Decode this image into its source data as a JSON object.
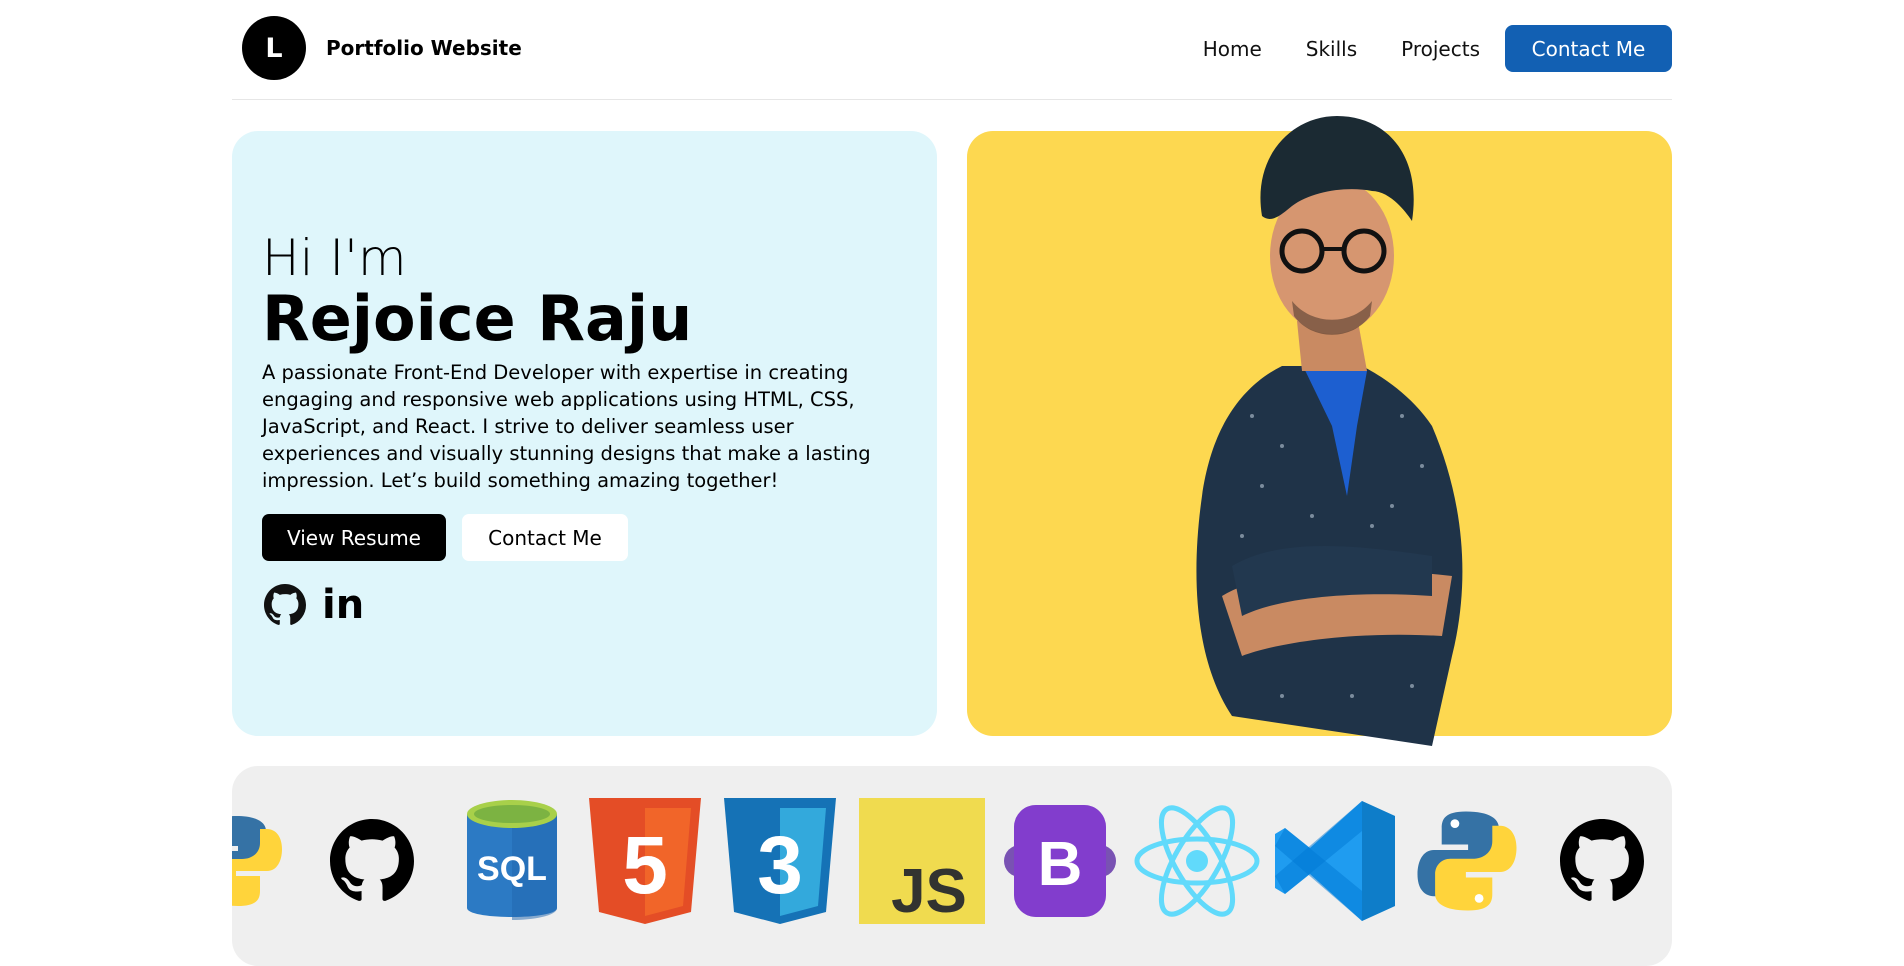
{
  "header": {
    "logo_letter": "L",
    "site_title": "Portfolio Website",
    "nav": [
      {
        "label": "Home"
      },
      {
        "label": "Skills"
      },
      {
        "label": "Projects"
      }
    ],
    "contact_label": "Contact Me"
  },
  "hero": {
    "greeting": "Hi I'm",
    "name": "Rejoice Raju",
    "bio": "A passionate Front-End Developer with expertise in creating engaging and responsive web applications using HTML, CSS, JavaScript, and React. I strive to deliver seamless user experiences and visually stunning designs that make a lasting impression. Let’s build something amazing together!",
    "resume_label": "View Resume",
    "contact_label": "Contact Me",
    "social": [
      {
        "icon": "github-icon"
      },
      {
        "icon": "linkedin-icon",
        "text": "in"
      }
    ]
  },
  "skills": {
    "icons": [
      "python-icon",
      "github-icon",
      "sql-icon",
      "html5-icon",
      "css3-icon",
      "javascript-icon",
      "bootstrap-icon",
      "react-icon",
      "vscode-icon",
      "python-icon",
      "github-icon"
    ],
    "sql_text": "SQL",
    "html_number": "5",
    "css_number": "3",
    "js_text": "JS",
    "bootstrap_letter": "B"
  },
  "colors": {
    "nav_accent": "#1260b3",
    "intro_bg": "#dff6fb",
    "photo_bg": "#fdd850",
    "skills_bg": "#efefef"
  }
}
